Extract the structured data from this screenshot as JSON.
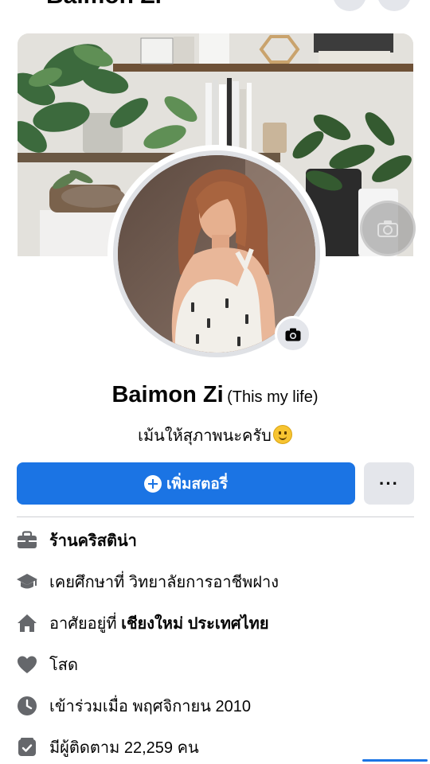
{
  "header": {
    "title": "Baimon Zi"
  },
  "profile": {
    "name": "Baimon Zi",
    "nickname": "(This my life)",
    "bio": "เม้นให้สุภาพนะครับ"
  },
  "actions": {
    "primary_label": "เพิ่มสตอรี่",
    "more_label": "···"
  },
  "details": [
    {
      "icon": "briefcase-icon",
      "prefix": "",
      "bold": "ร้านคริสติน่า"
    },
    {
      "icon": "graduation-cap-icon",
      "prefix": "เคยศึกษาที่ ",
      "bold": "วิทยาลัยการอาชีพฝาง"
    },
    {
      "icon": "home-icon",
      "prefix": "อาศัยอยู่ที่ ",
      "bold": "เชียงใหม่ ประเทศไทย"
    },
    {
      "icon": "heart-icon",
      "prefix": "โสด",
      "bold": ""
    },
    {
      "icon": "clock-icon",
      "prefix": "เข้าร่วมเมื่อ พฤศจิกายน  2010",
      "bold": ""
    },
    {
      "icon": "followers-icon",
      "prefix": "มีผู้ติดตาม 22,259 คน",
      "bold": ""
    }
  ],
  "colors": {
    "accent": "#1b74e4",
    "secondary_button": "#e4e6eb",
    "icon_gray": "#65676b"
  }
}
